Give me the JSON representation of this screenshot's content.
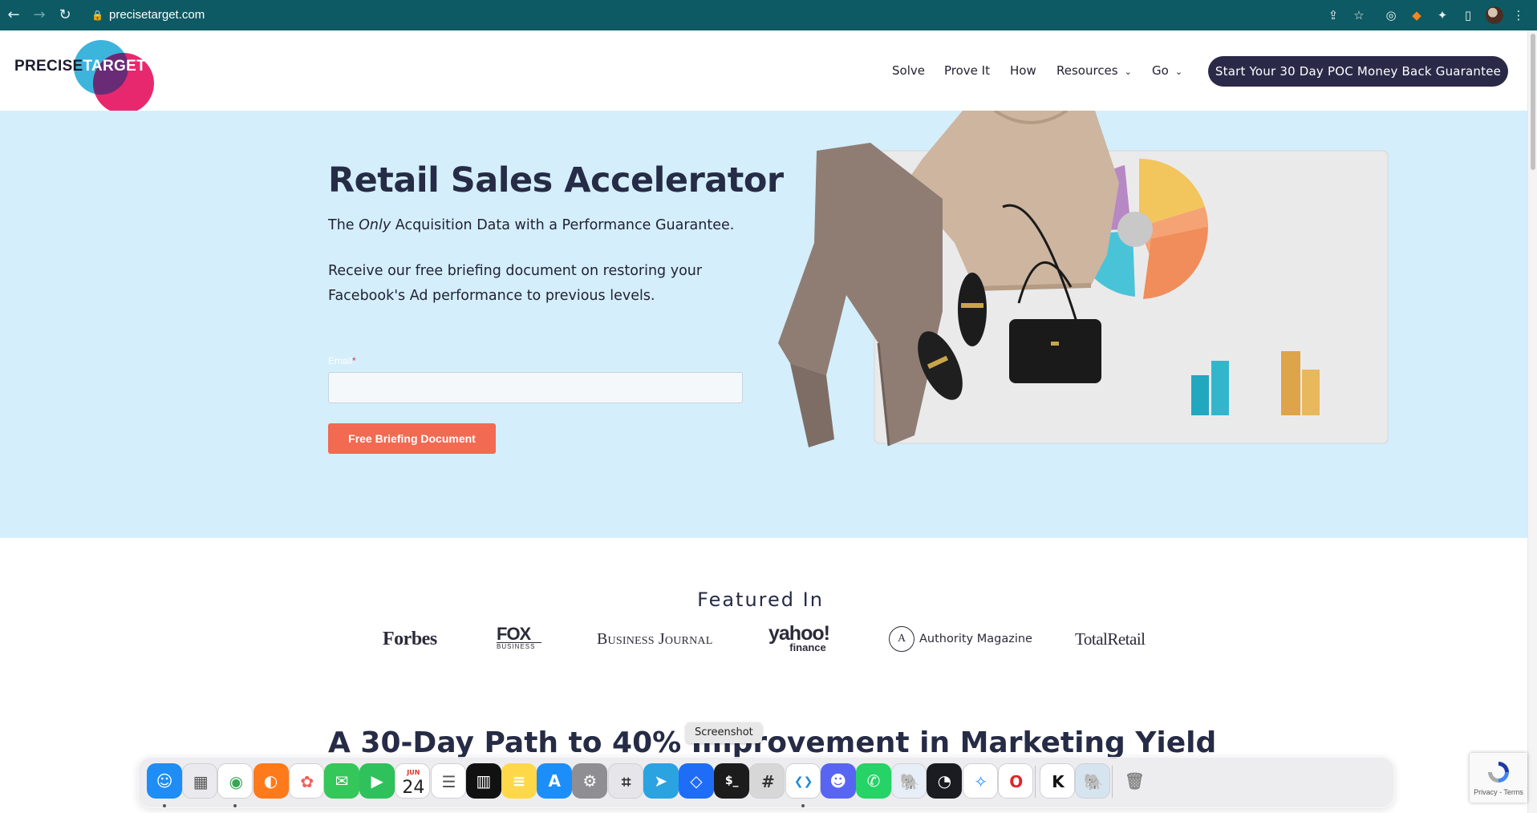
{
  "browser": {
    "url": "precisetarget.com",
    "back_icon": "arrow-left-icon",
    "forward_icon": "arrow-right-icon",
    "reload_icon": "reload-icon"
  },
  "header": {
    "logo_word_1": "PRECISE",
    "logo_word_2": "TARGET",
    "nav": [
      {
        "label": "Solve"
      },
      {
        "label": "Prove It"
      },
      {
        "label": "How"
      },
      {
        "label": "Resources",
        "has_dropdown": true
      },
      {
        "label": "Go",
        "has_dropdown": true
      }
    ],
    "cta_label": "Start Your 30 Day POC Money Back Guarantee",
    "colors": {
      "cta_bg": "#2a2a48",
      "logo_blue": "#3cb4dc",
      "logo_pink": "#e8286e"
    }
  },
  "hero": {
    "title": "Retail Sales Accelerator",
    "tagline_prefix": "The ",
    "tagline_emphasis": "Only",
    "tagline_suffix": " Acquisition Data with a Performance Guarantee.",
    "description": "Receive our free briefing document on restoring your Facebook's Ad performance to previous levels.",
    "email_label": "Email",
    "email_required_mark": "*",
    "email_value": "",
    "submit_label": "Free Briefing Document",
    "colors": {
      "background": "#d4eefb",
      "submit_bg": "#f26a51"
    }
  },
  "featured": {
    "title": "Featured In",
    "outlets": {
      "forbes": "Forbes",
      "fox_main": "FOX",
      "fox_sub": "BUSINESS",
      "business_journal": "Business Journal",
      "yahoo_main": "yahoo!",
      "yahoo_sub": "finance",
      "authority_mark": "A",
      "authority": "Authority Magazine",
      "total_retail": "TotalRetail"
    }
  },
  "section2": {
    "title": "A 30-Day Path to 40% Improvement in Marketing Yield"
  },
  "tooltip": {
    "text": "Screenshot"
  },
  "dock": {
    "apps": [
      {
        "name": "Finder",
        "icon": "finder-icon",
        "color": "#1e8df5",
        "running": true
      },
      {
        "name": "Launchpad",
        "icon": "launchpad-icon",
        "color": "#e9e9ee"
      },
      {
        "name": "Chrome",
        "icon": "chrome-icon",
        "color": "#ffffff",
        "running": true
      },
      {
        "name": "Firefox",
        "icon": "firefox-icon",
        "color": "#ff7a1a"
      },
      {
        "name": "Photos",
        "icon": "photos-icon",
        "color": "#ffffff"
      },
      {
        "name": "Messages",
        "icon": "messages-icon",
        "color": "#34c759"
      },
      {
        "name": "FaceTime",
        "icon": "facetime-icon",
        "color": "#2fc15b"
      },
      {
        "name": "Calendar",
        "icon": "calendar-icon",
        "color": "#ffffff",
        "month": "JUN",
        "day": "24"
      },
      {
        "name": "Reminders",
        "icon": "reminders-icon",
        "color": "#ffffff"
      },
      {
        "name": "Stage Manager",
        "icon": "stage-manager-icon",
        "color": "#111111"
      },
      {
        "name": "Notes",
        "icon": "notes-icon",
        "color": "#ffd84a"
      },
      {
        "name": "App Store",
        "icon": "app-store-icon",
        "color": "#1c8ef9"
      },
      {
        "name": "System Settings",
        "icon": "settings-icon",
        "color": "#8e8e93"
      },
      {
        "name": "Screenshot",
        "icon": "screenshot-icon",
        "color": "#e5e5ea"
      },
      {
        "name": "Telegram",
        "icon": "telegram-icon",
        "color": "#2aa3e0"
      },
      {
        "name": "Dropbox",
        "icon": "dropbox-icon",
        "color": "#1f6cf7"
      },
      {
        "name": "Terminal",
        "icon": "terminal-icon",
        "color": "#1c1c1c"
      },
      {
        "name": "Calculator",
        "icon": "calculator-icon",
        "color": "#d7d7d7"
      },
      {
        "name": "VS Code",
        "icon": "vscode-icon",
        "color": "#ffffff",
        "running": true
      },
      {
        "name": "Discord",
        "icon": "discord-icon",
        "color": "#5865f2"
      },
      {
        "name": "WhatsApp",
        "icon": "whatsapp-icon",
        "color": "#25d366"
      },
      {
        "name": "pgAdmin",
        "icon": "elephant-icon",
        "color": "#e8eef7"
      },
      {
        "name": "Speedometer",
        "icon": "speedometer-icon",
        "color": "#1b1b22"
      },
      {
        "name": "Safari",
        "icon": "safari-icon",
        "color": "#ffffff"
      },
      {
        "name": "Opera",
        "icon": "opera-icon",
        "color": "#ffffff"
      },
      {
        "name": "Klack",
        "icon": "k-icon",
        "color": "#ffffff"
      },
      {
        "name": "Postgres",
        "icon": "elephant-icon",
        "color": "#d6e4f0"
      },
      {
        "name": "Trash",
        "icon": "trash-icon",
        "color": "transparent"
      }
    ]
  },
  "recaptcha": {
    "footer": "Privacy - Terms"
  }
}
